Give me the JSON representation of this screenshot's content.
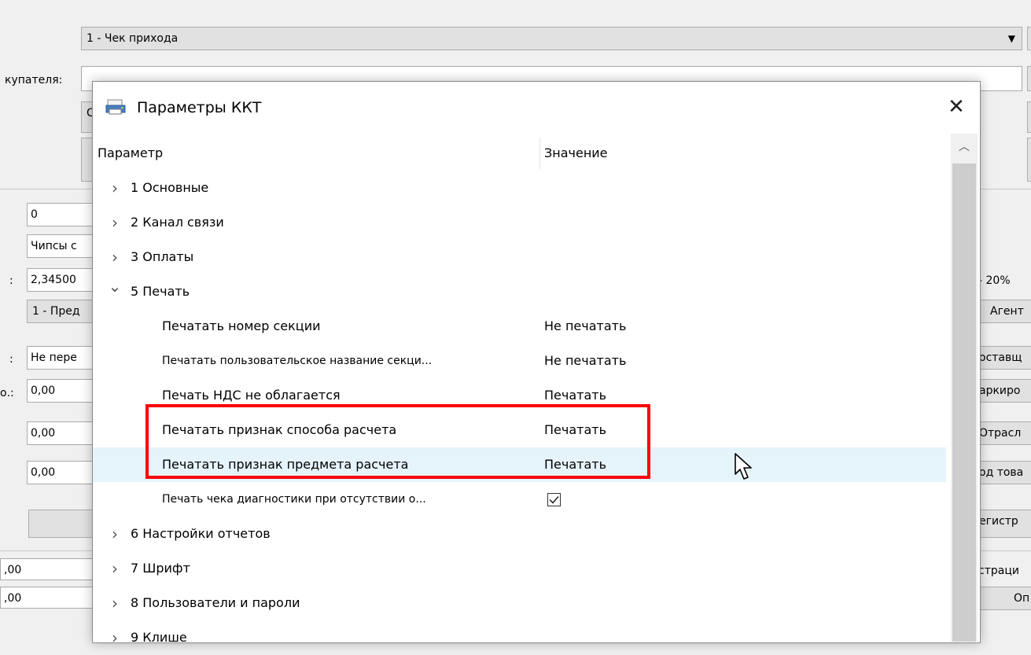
{
  "background": {
    "doc_type_select": "1 - Чек прихода",
    "buyer_label": "купателя:",
    "left_fields": [
      {
        "value": "0"
      },
      {
        "value": "Чипсы с"
      },
      {
        "value": "2,34500",
        "label": ":"
      },
      {
        "value": "1 - Пред"
      },
      {
        "value": "Не пере",
        "label": ":"
      },
      {
        "value": "0,00",
        "label": "о.:"
      },
      {
        "value": "0,00"
      },
      {
        "value": "0,00"
      },
      {
        "value": ""
      }
    ],
    "bottom_fields": [
      {
        "value": ",00"
      },
      {
        "value": ",00"
      }
    ],
    "right_items": [
      {
        "text": "- 20%"
      },
      {
        "text": "Агент"
      },
      {
        "text": "оставщ"
      },
      {
        "text": "аркиро"
      },
      {
        "text": "Отрасл"
      },
      {
        "text": "од това"
      },
      {
        "text": "егистр"
      },
      {
        "text": "страци"
      },
      {
        "text": "Оп"
      }
    ],
    "partial_char": "С"
  },
  "dialog": {
    "title": "Параметры ККТ",
    "header": {
      "param": "Параметр",
      "value": "Значение"
    },
    "rows": [
      {
        "kind": "group",
        "expanded": false,
        "name": "1 Основные"
      },
      {
        "kind": "group",
        "expanded": false,
        "name": "2 Канал связи"
      },
      {
        "kind": "group",
        "expanded": false,
        "name": "3 Оплаты"
      },
      {
        "kind": "group",
        "expanded": true,
        "name": "5 Печать"
      },
      {
        "kind": "param",
        "name": "Печатать номер секции",
        "value": "Не печатать"
      },
      {
        "kind": "param",
        "name": "Печатать пользовательское название секци...",
        "value": "Не печатать",
        "small": true
      },
      {
        "kind": "param",
        "name": "Печать НДС не облагается",
        "value": "Печатать"
      },
      {
        "kind": "param",
        "name": "Печатать признак способа расчета",
        "value": "Печатать"
      },
      {
        "kind": "param",
        "name": "Печатать признак предмета расчета",
        "value": "Печатать",
        "hover": true
      },
      {
        "kind": "checkbox",
        "name": "Печать чека диагностики при отсутствии о...",
        "checked": true,
        "small": true
      },
      {
        "kind": "group",
        "expanded": false,
        "name": "6 Настройки отчетов"
      },
      {
        "kind": "group",
        "expanded": false,
        "name": "7 Шрифт"
      },
      {
        "kind": "group",
        "expanded": false,
        "name": "8 Пользователи и пароли"
      },
      {
        "kind": "group",
        "expanded": false,
        "name": "9 Клише"
      }
    ]
  },
  "colors": {
    "highlight_border": "#ff0000",
    "hover_row": "#e5f3fb"
  }
}
